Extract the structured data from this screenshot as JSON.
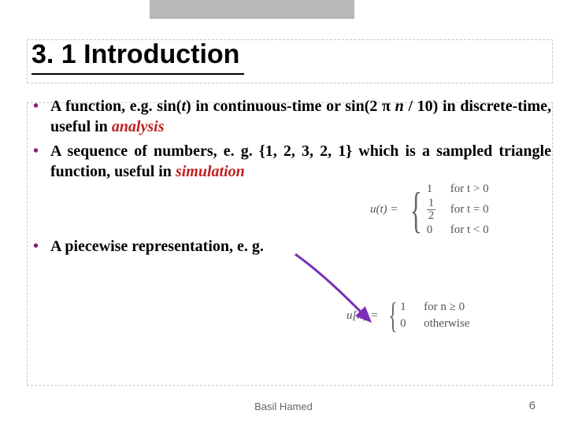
{
  "title": "3. 1 Introduction",
  "bullets": {
    "b1_pre": "A function, e.g. sin(",
    "b1_t": "t",
    "b1_mid": ") in continuous-time or sin(2 ",
    "b1_pi": "π",
    "b1_n": " n",
    "b1_post": " / 10) in discrete-time, useful in ",
    "b1_analysis": "analysis",
    "b2_pre": "A sequence of numbers, e. g. {1, 2, 3, 2, 1} which is a sampled triangle function, useful in ",
    "b2_sim": "simulation",
    "b3": "A piecewise representation, e. g."
  },
  "math1": {
    "lhs": "u(t) = ",
    "r1v": "1",
    "r1c": "for t > 0",
    "r2n": "1",
    "r2d": "2",
    "r2c": "for t = 0",
    "r3v": "0",
    "r3c": "for t < 0"
  },
  "math2": {
    "lhs": "u[n] = ",
    "r1v": "1",
    "r1c": "for n ≥ 0",
    "r2v": "0",
    "r2c": "otherwise"
  },
  "footer": {
    "author": "Basil Hamed",
    "page": "6"
  }
}
